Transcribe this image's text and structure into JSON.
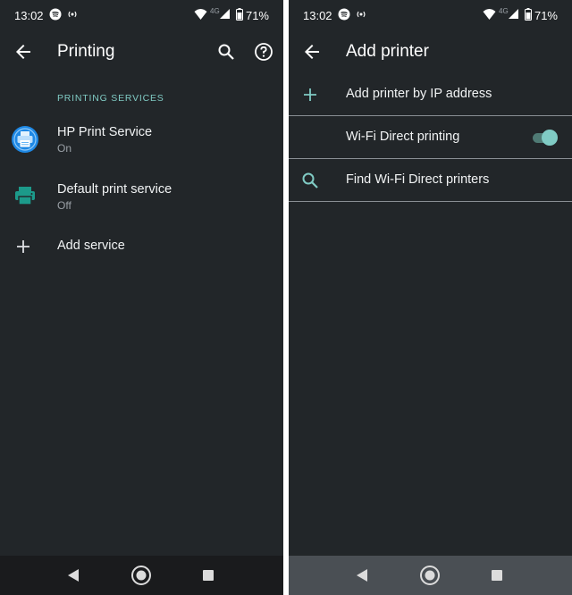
{
  "left": {
    "status": {
      "time": "13:02",
      "network": "4G",
      "battery": "71%"
    },
    "appbar": {
      "title": "Printing"
    },
    "section_header": "PRINTING SERVICES",
    "services": [
      {
        "title": "HP Print Service",
        "subtitle": "On",
        "icon": "hp-printer-icon"
      },
      {
        "title": "Default print service",
        "subtitle": "Off",
        "icon": "printer-icon"
      }
    ],
    "add_service_label": "Add service"
  },
  "right": {
    "status": {
      "time": "13:02",
      "network": "4G",
      "battery": "71%"
    },
    "appbar": {
      "title": "Add printer"
    },
    "rows": {
      "add_by_ip": "Add printer by IP address",
      "wifi_direct": "Wi-Fi Direct printing",
      "find_wifi": "Find Wi-Fi Direct printers"
    },
    "wifi_direct_enabled": true
  },
  "colors": {
    "background": "#222629",
    "accent": "#80cbc4",
    "divider": "#8a8f94"
  }
}
